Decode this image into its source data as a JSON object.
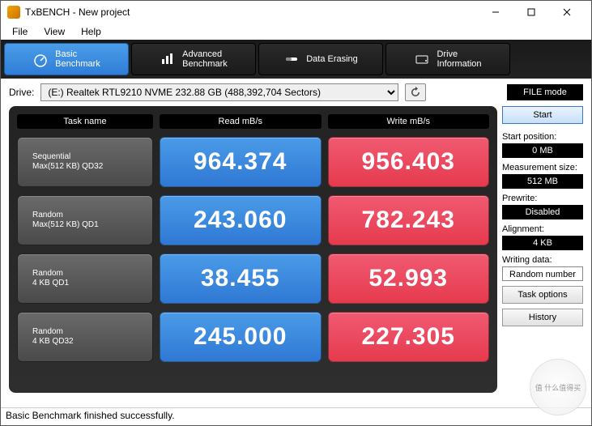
{
  "window": {
    "title": "TxBENCH - New project"
  },
  "menu": {
    "file": "File",
    "view": "View",
    "help": "Help"
  },
  "tabs": {
    "basic": "Basic\nBenchmark",
    "advanced": "Advanced\nBenchmark",
    "erase": "Data Erasing",
    "drive": "Drive\nInformation"
  },
  "drive": {
    "label": "Drive:",
    "selected": "(E:) Realtek RTL9210 NVME  232.88 GB (488,392,704 Sectors)"
  },
  "filemode": "FILE mode",
  "headers": {
    "task": "Task name",
    "read": "Read mB/s",
    "write": "Write mB/s"
  },
  "rows": [
    {
      "name1": "Sequential",
      "name2": "Max(512 KB) QD32",
      "read": "964.374",
      "write": "956.403"
    },
    {
      "name1": "Random",
      "name2": "Max(512 KB) QD1",
      "read": "243.060",
      "write": "782.243"
    },
    {
      "name1": "Random",
      "name2": "4 KB QD1",
      "read": "38.455",
      "write": "52.993"
    },
    {
      "name1": "Random",
      "name2": "4 KB QD32",
      "read": "245.000",
      "write": "227.305"
    }
  ],
  "side": {
    "start": "Start",
    "startpos_label": "Start position:",
    "startpos": "0 MB",
    "meassize_label": "Measurement size:",
    "meassize": "512 MB",
    "prewrite_label": "Prewrite:",
    "prewrite": "Disabled",
    "align_label": "Alignment:",
    "align": "4 KB",
    "wdata_label": "Writing data:",
    "wdata": "Random number",
    "taskopt": "Task options",
    "history": "History"
  },
  "status": "Basic Benchmark finished successfully.",
  "watermark": "值 什么值得买"
}
